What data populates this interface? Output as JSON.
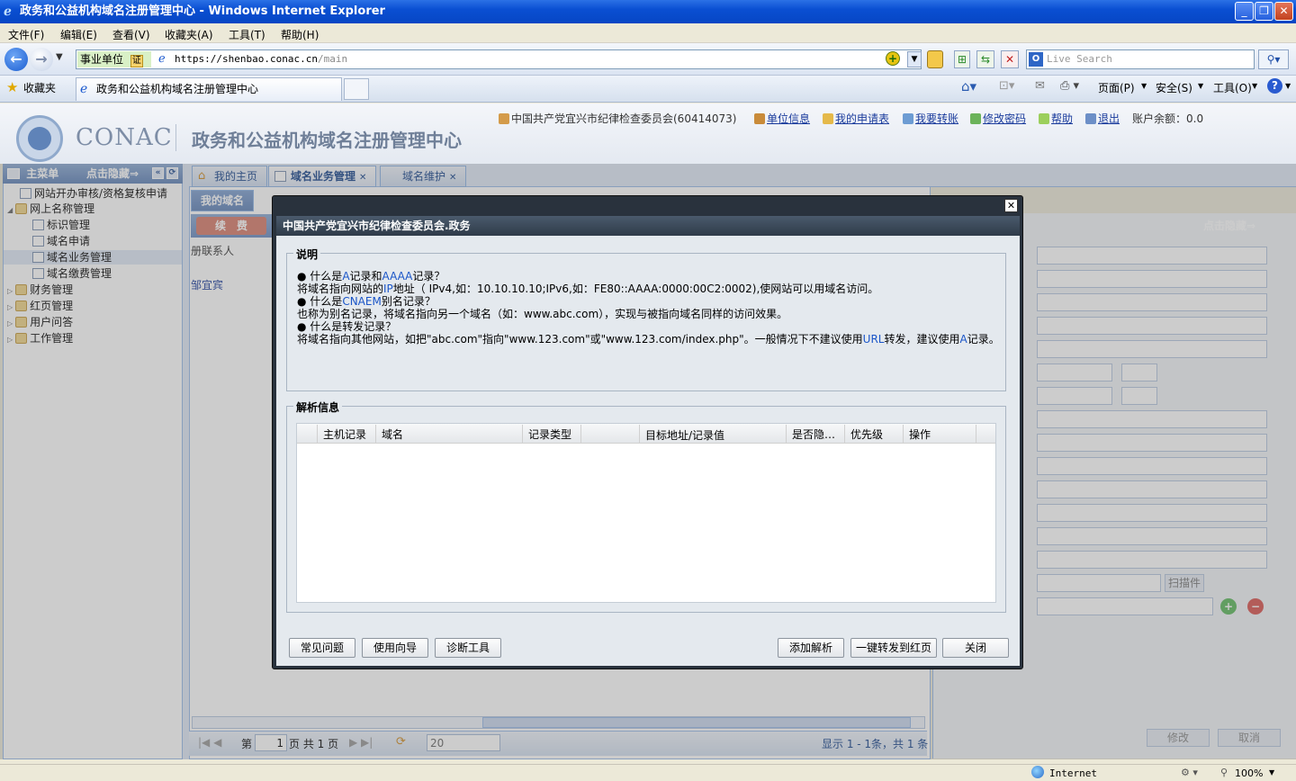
{
  "window": {
    "title": "政务和公益机构域名注册管理中心 - Windows Internet Explorer",
    "controls": [
      "_",
      "❐",
      "✕"
    ]
  },
  "menubar": [
    "文件(F)",
    "编辑(E)",
    "查看(V)",
    "收藏夹(A)",
    "工具(T)",
    "帮助(H)"
  ],
  "addressbar": {
    "cert_label": "事业单位",
    "cert_badge": "证",
    "url_prefix": "https://",
    "url_host": "shenbao.conac.cn",
    "url_path": "/main",
    "search_placeholder": "Live Search"
  },
  "tabbar": {
    "favorites": "收藏夹",
    "tab_title": "政务和公益机构域名注册管理中心",
    "tools": [
      "页面(P)",
      "安全(S)",
      "工具(O)"
    ]
  },
  "header": {
    "brand": "CONAC",
    "system_name": "政务和公益机构域名注册管理中心",
    "user": "中国共产党宜兴市纪律检查委员会(60414073)",
    "links": [
      "单位信息",
      "我的申请表",
      "我要转账",
      "修改密码",
      "帮助",
      "退出"
    ],
    "balance": "账户余额：0.0"
  },
  "leftmenu": {
    "title": "主菜单",
    "hide_label": "点击隐藏⇒",
    "items": [
      {
        "label": "网站开办审核/资格复核申请",
        "type": "doc"
      },
      {
        "label": "网上名称管理",
        "type": "folder"
      },
      {
        "label": "标识管理",
        "type": "doc"
      },
      {
        "label": "域名申请",
        "type": "doc"
      },
      {
        "label": "域名业务管理",
        "type": "doc"
      },
      {
        "label": "域名缴费管理",
        "type": "doc"
      },
      {
        "label": "财务管理",
        "type": "folder"
      },
      {
        "label": "红页管理",
        "type": "folder"
      },
      {
        "label": "用户问答",
        "type": "folder"
      },
      {
        "label": "工作管理",
        "type": "folder"
      }
    ]
  },
  "center": {
    "tabs": [
      "我的主页",
      "域名业务管理",
      "域名维护"
    ],
    "subtab": "我的域名",
    "renew_button": "续　费",
    "col_contact": "册联系人",
    "row_contact": "邹宜宾",
    "right_hide": "点击隐藏⇒",
    "pager_page_label": "第",
    "pager_page": "1",
    "pager_total": "页 共 1 页",
    "pager_size": "20",
    "pager_info": "显示 1 - 1条，共 1 条",
    "right_buttons": [
      "修改",
      "取消"
    ],
    "scan_button": "扫描件"
  },
  "dialog": {
    "title": "中国共产党宜兴市纪律检查委员会.政务",
    "explain_legend": "说明",
    "explain_lines": [
      {
        "bullet": true,
        "pre": "什么是",
        "blue": "A",
        "mid": "记录和",
        "blue2": "AAAA",
        "post": "记录？"
      },
      {
        "bullet": false,
        "pre": "将域名指向网站的",
        "blue": "IP",
        "mid": "地址（ IPv4,如：10.10.10.10;IPv6,如：FE80::AAAA:0000:00C2:0002),使网站可以用域名访问。",
        "blue2": "",
        "post": ""
      },
      {
        "bullet": true,
        "pre": "什么是",
        "blue": "CNAEM",
        "mid": "别名记录？",
        "blue2": "",
        "post": ""
      },
      {
        "bullet": false,
        "pre": "也称为别名记录，将域名指向另一个域名（如：www.abc.com），实现与被指向域名同样的访问效果。",
        "blue": "",
        "mid": "",
        "blue2": "",
        "post": ""
      },
      {
        "bullet": true,
        "pre": "什么是转发记录？",
        "blue": "",
        "mid": "",
        "blue2": "",
        "post": ""
      },
      {
        "bullet": false,
        "pre": "将域名指向其他网站，如把\"abc.com\"指向\"www.123.com\"或\"www.123.com/index.php\"。一般情况下不建议使用",
        "blue": "URL",
        "mid": "转发，建议使用",
        "blue2": "A",
        "post": "记录。"
      }
    ],
    "grid_legend": "解析信息",
    "columns": [
      "主机记录",
      "域名",
      "记录类型",
      "目标地址/记录值",
      "是否隐…",
      "优先级",
      "操作"
    ],
    "buttons_left": [
      "常见问题",
      "使用向导",
      "诊断工具"
    ],
    "buttons_right": [
      "添加解析",
      "一键转发到红页",
      "关闭"
    ]
  },
  "statusbar": {
    "zone": "Internet",
    "zoom": "100%"
  }
}
